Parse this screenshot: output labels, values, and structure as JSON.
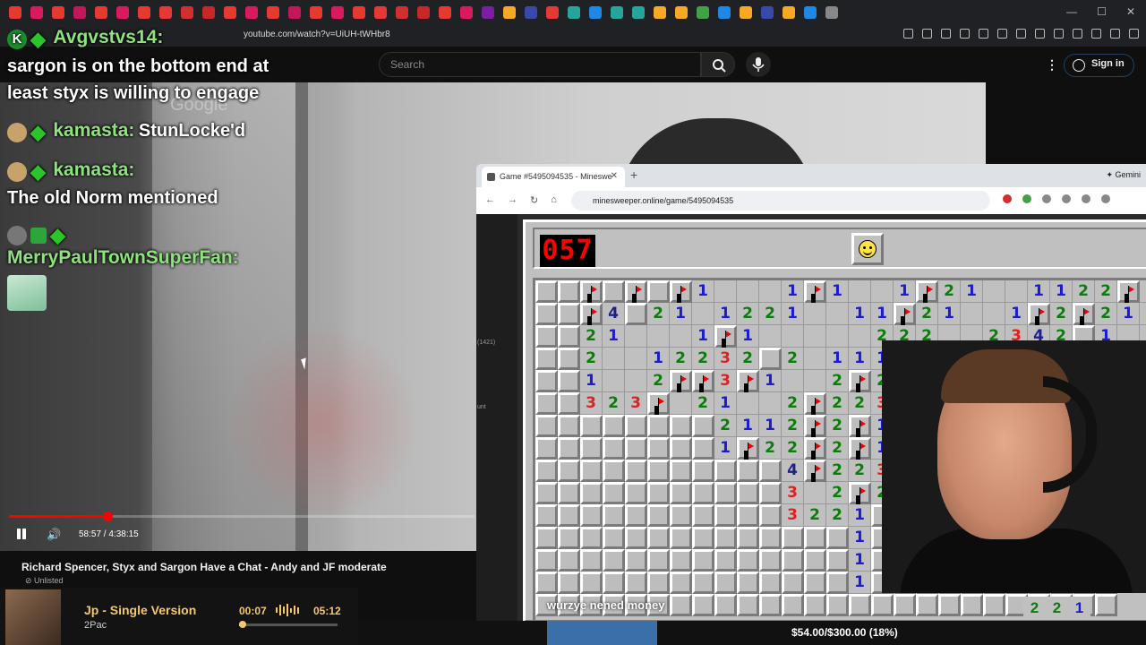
{
  "browser": {
    "url": "youtube.com/watch?v=UiUH-tWHbr8",
    "tab_colors": [
      "#e53935",
      "#d81b60",
      "#e53935",
      "#c2185b",
      "#e53935",
      "#d81b60",
      "#e53935",
      "#e53935",
      "#d32f2f",
      "#c62828",
      "#e53935",
      "#d81b60",
      "#e53935",
      "#c2185b",
      "#e53935",
      "#d81b60",
      "#e53935",
      "#e53935",
      "#d32f2f",
      "#c62828",
      "#e53935",
      "#d81b60",
      "#7b1fa2",
      "#f9a825",
      "#3949ab",
      "#e53935",
      "#26a69a",
      "#1e88e5",
      "#26a69a",
      "#26a69a",
      "#f9a825",
      "#f9a825",
      "#43a047",
      "#1e88e5",
      "#f9a825",
      "#3949ab",
      "#f9a825",
      "#1e88e5",
      "#888888"
    ]
  },
  "youtube": {
    "search_placeholder": "Search",
    "sign_in": "Sign in",
    "video_time": "58:57 / 4:38:15",
    "progress_fraction": 0.212,
    "video_title": "Richard Spencer, Styx and Sargon Have a Chat - Andy and JF moderate",
    "unlisted": "Unlisted",
    "watermark": "Google"
  },
  "chat": {
    "line1_name": "Avgvstvs14:",
    "line1_msg_a": "sargon is on the bottom end at",
    "line1_msg_b": "least styx is willing to engage",
    "line2_name": "kamasta:",
    "line2_msg": "StunLocke'd",
    "line3_name": "kamasta:",
    "line3_msg": "The old Norm mentioned",
    "line4_name": "MerryPaulTownSuperFan:"
  },
  "minesweeper": {
    "tab_title": "Game #5495094535 - Mineswe",
    "url": "minesweeper.online/game/5495094535",
    "gemini": "Gemini",
    "side_count": "(1421)",
    "side_label": "unt",
    "counter": "057",
    "rows": [
      "ccF F F1ooo1F1oo1F21oo1122F1ooc",
      "ccF4 21o1221oo11F21oo1F2F21oo1",
      "cc21ooo1F1ooooo222oo2342 1oooo2",
      "cc2oo12232 2o111F2F2o1ooooooo2",
      "cc1oo2FF3F1oo2F23F33oooooo333",
      "cc323Fo21oo2F223F22oooooooF1",
      "cccccccc2112F2F1F223F2oooooo5",
      "cccccccc1F22F2F1F13F2ooooooo3",
      "ccccccccccc4F223F1oooooooo",
      "ccccccccccc3o2F21oooooooo",
      "ccccccccccc3221ccccccccccc",
      "cccccccccccccc1ccccccccccc",
      "cccccccccccccc1ccccccccccc",
      "cccccccccccccc1ccccccccccc",
      "cccccccccccccccccccccccccc"
    ],
    "caption": "wurzye nened money",
    "bottom_numbers": [
      "2",
      "2",
      "1"
    ]
  },
  "stream": {
    "goal": "$54.00/$300.00 (18%)",
    "song": "Jp - Single Version",
    "artist": "2Pac",
    "elapsed": "00:07",
    "duration": "05:12",
    "song_progress_fraction": 0.022
  }
}
